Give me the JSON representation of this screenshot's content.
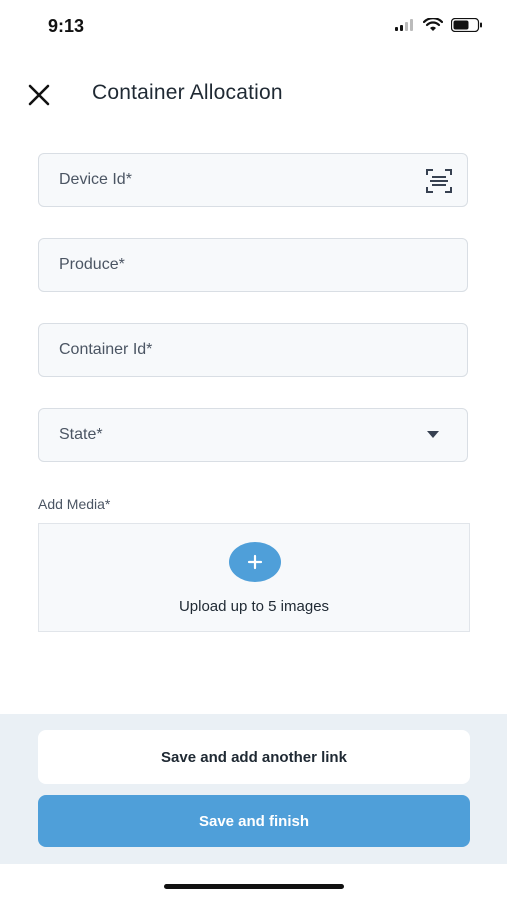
{
  "status_bar": {
    "time": "9:13",
    "icons": [
      "signal-icon",
      "wifi-icon",
      "battery-icon"
    ]
  },
  "header": {
    "title": "Container Allocation",
    "close_icon": "close-icon"
  },
  "form": {
    "device_id": {
      "placeholder": "Device Id*",
      "icon": "barcode-scan-icon"
    },
    "produce": {
      "placeholder": "Produce*"
    },
    "container_id": {
      "placeholder": "Container Id*"
    },
    "state": {
      "placeholder": "State*",
      "icon": "dropdown-arrow-icon"
    }
  },
  "media": {
    "label": "Add Media*",
    "upload_text": "Upload up to 5 images",
    "add_icon": "plus-icon"
  },
  "footer": {
    "secondary_label": "Save and add another link",
    "primary_label": "Save and finish"
  },
  "colors": {
    "accent": "#4f9fd9",
    "field_bg": "#f7f9fb",
    "field_border": "#d9dee4",
    "footer_bg": "#eaf0f5"
  }
}
